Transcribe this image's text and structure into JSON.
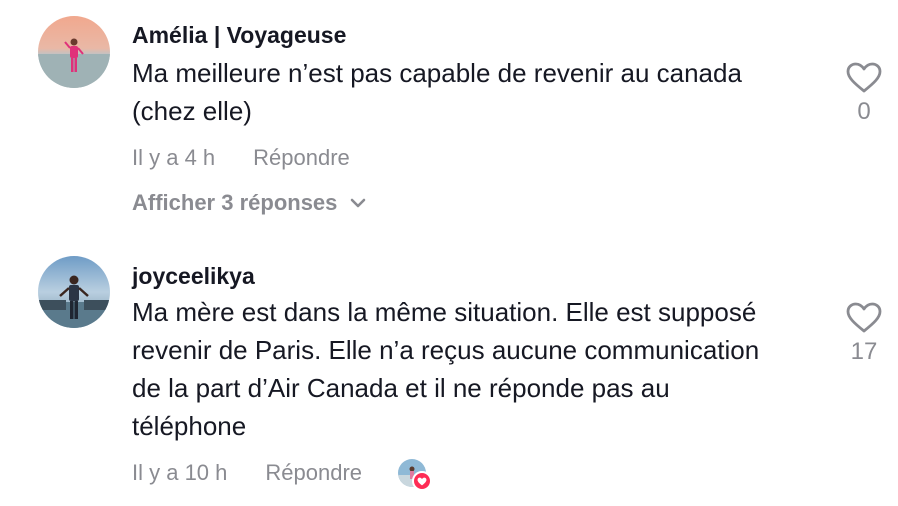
{
  "comments": [
    {
      "username": "Amélia | Voyageuse",
      "text": "Ma meilleure n’est pas capable de revenir au canada (chez elle)",
      "time": "Il y a 4 h",
      "reply_label": "Répondre",
      "view_replies_label": "Afficher 3 réponses",
      "like_count": "0"
    },
    {
      "username": "joyceelikya",
      "text": "Ma mère est dans la même situation. Elle est supposé revenir de Paris. Elle n’a reçus aucune communication de la part d’Air Canada et il ne réponde pas au téléphone",
      "time": "Il y a 10 h",
      "reply_label": "Répondre",
      "like_count": "17"
    }
  ],
  "icons": {
    "like": "heart-outline-icon",
    "expand": "chevron-down-icon",
    "creator_badge": "heart-filled-icon"
  },
  "colors": {
    "text": "#161823",
    "secondary": "#8a8b91",
    "accent": "#fe2c55"
  }
}
